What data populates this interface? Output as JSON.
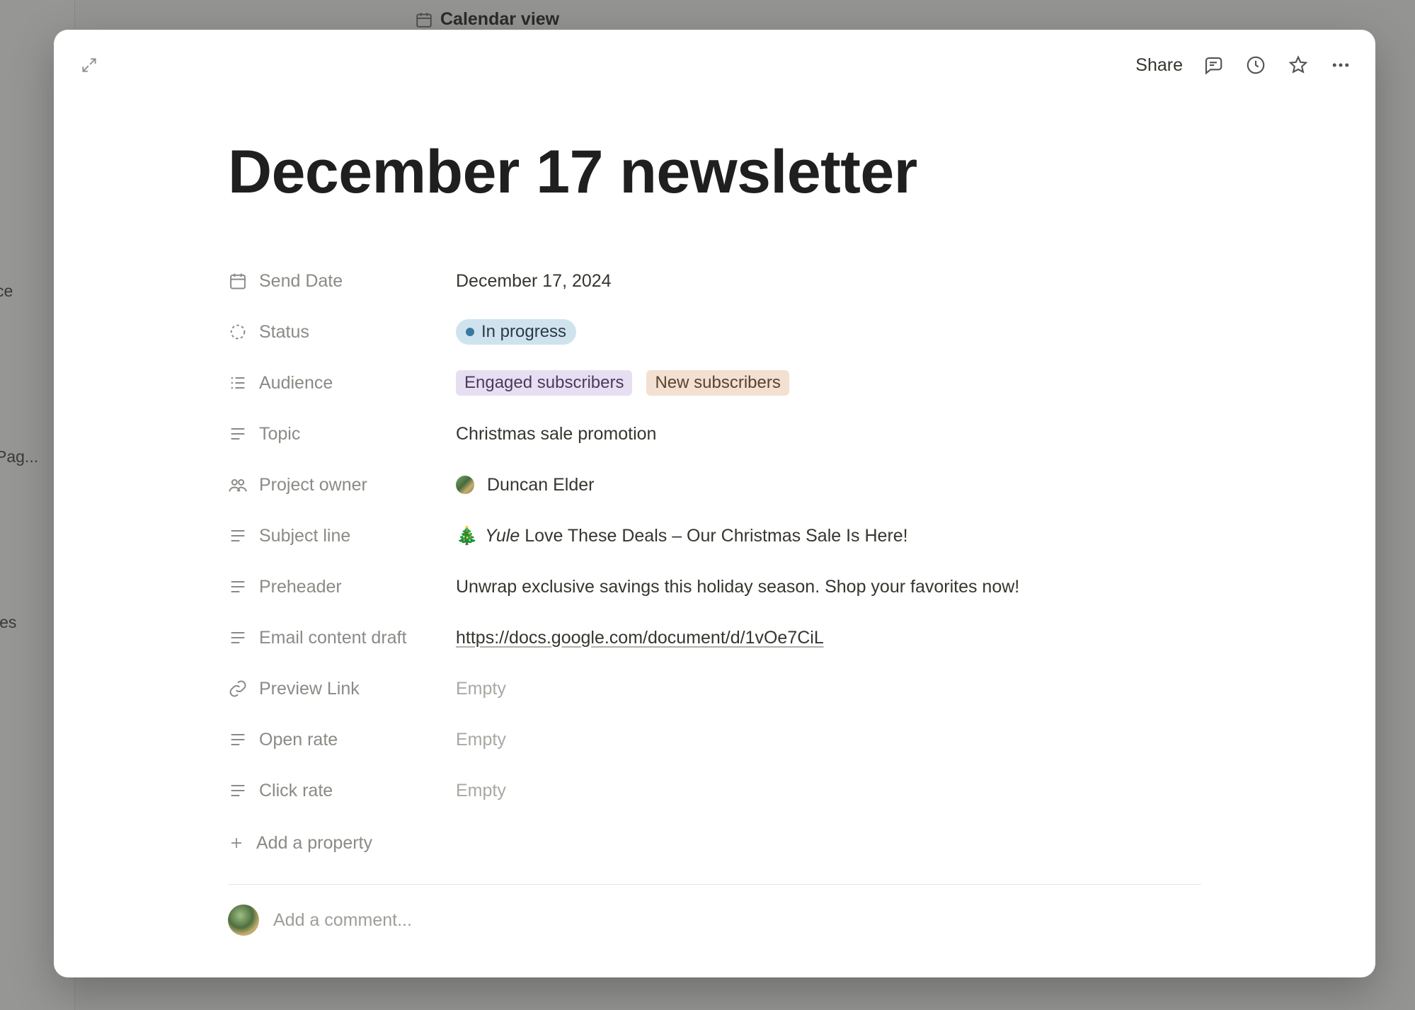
{
  "background": {
    "calendar_tab": "Calendar view",
    "sidebar_item_1": "ce",
    "sidebar_item_2": "Pag...",
    "sidebar_item_3": "les"
  },
  "topbar": {
    "share_label": "Share"
  },
  "page": {
    "title": "December 17 newsletter"
  },
  "properties": {
    "send_date": {
      "label": "Send Date",
      "value": "December 17, 2024"
    },
    "status": {
      "label": "Status",
      "value": "In progress"
    },
    "audience": {
      "label": "Audience",
      "tags": [
        "Engaged subscribers",
        "New subscribers"
      ]
    },
    "topic": {
      "label": "Topic",
      "value": "Christmas sale promotion"
    },
    "owner": {
      "label": "Project owner",
      "value": "Duncan Elder"
    },
    "subject": {
      "label": "Subject line",
      "emoji": "🎄",
      "italic": "Yule",
      "rest": " Love These Deals – Our Christmas Sale Is Here!"
    },
    "preheader": {
      "label": "Preheader",
      "value": "Unwrap exclusive savings this holiday season. Shop your favorites now!"
    },
    "draft": {
      "label": "Email content draft",
      "url": "https://docs.google.com/document/d/1vOe7CiL"
    },
    "preview": {
      "label": "Preview Link",
      "value": "Empty"
    },
    "open_rate": {
      "label": "Open rate",
      "value": "Empty"
    },
    "click_rate": {
      "label": "Click rate",
      "value": "Empty"
    }
  },
  "add_property_label": "Add a property",
  "comment_placeholder": "Add a comment..."
}
